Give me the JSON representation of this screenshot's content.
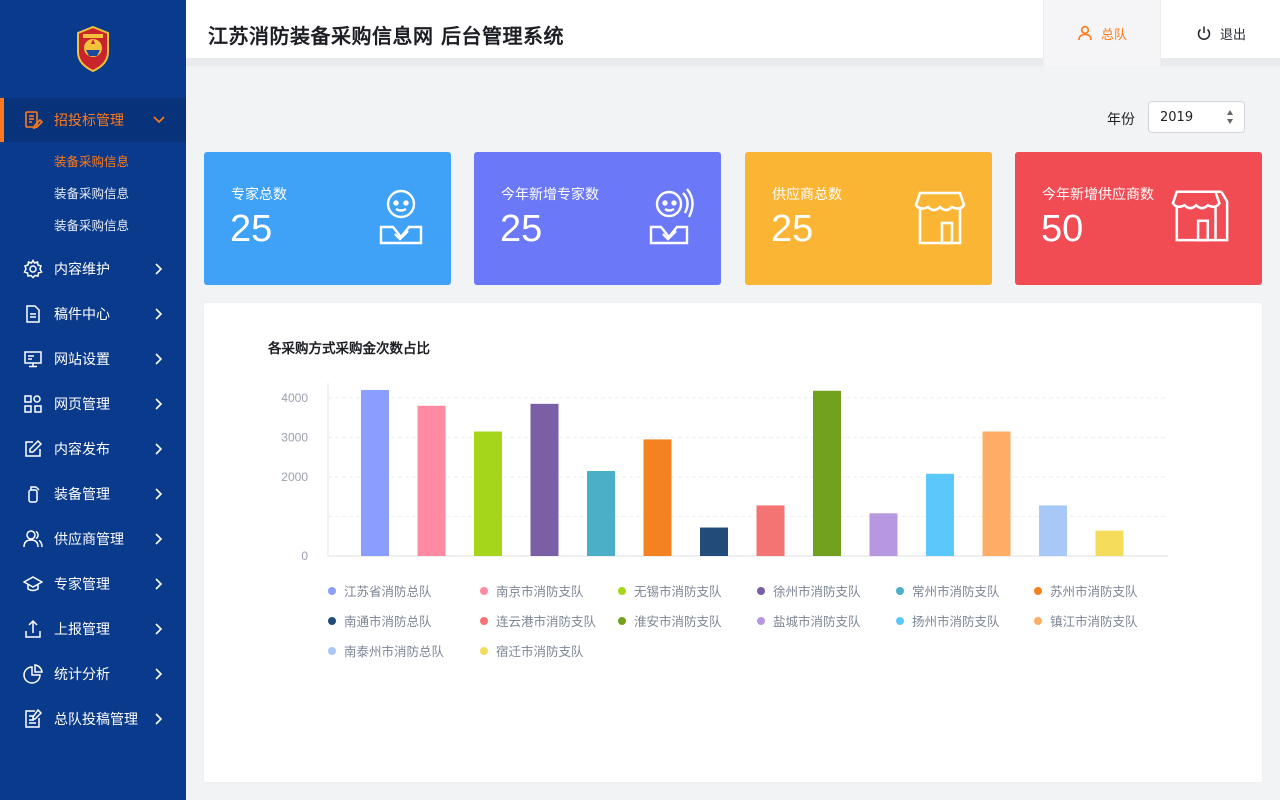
{
  "header": {
    "title": "江苏消防装备采购信息网  后台管理系统",
    "user_label": "总队",
    "logout_label": "退出"
  },
  "sidebar": {
    "active": {
      "label": "招投标管理",
      "icon": "document-edit-icon",
      "sub_items": [
        "装备采购信息",
        "装备采购信息",
        "装备采购信息"
      ]
    },
    "items": [
      {
        "label": "内容维护",
        "icon": "gear-icon"
      },
      {
        "label": "稿件中心",
        "icon": "file-icon"
      },
      {
        "label": "网站设置",
        "icon": "monitor-icon"
      },
      {
        "label": "网页管理",
        "icon": "grid-icon"
      },
      {
        "label": "内容发布",
        "icon": "edit-icon"
      },
      {
        "label": "装备管理",
        "icon": "extinguisher-icon"
      },
      {
        "label": "供应商管理",
        "icon": "users-icon"
      },
      {
        "label": "专家管理",
        "icon": "graduation-cap-icon"
      },
      {
        "label": "上报管理",
        "icon": "upload-icon"
      },
      {
        "label": "统计分析",
        "icon": "pie-chart-icon"
      },
      {
        "label": "总队投稿管理",
        "icon": "submission-icon"
      }
    ]
  },
  "filter": {
    "year_label": "年份",
    "year_value": "2019"
  },
  "cards": [
    {
      "label": "专家总数",
      "value": "25",
      "color": "#3fa2f7",
      "icon": "expert-icon"
    },
    {
      "label": "今年新增专家数",
      "value": "25",
      "color": "#6b78f7",
      "icon": "new-expert-icon"
    },
    {
      "label": "供应商总数",
      "value": "25",
      "color": "#fbb534",
      "icon": "store-icon"
    },
    {
      "label": "今年新增供应商数",
      "value": "50",
      "color": "#f14b54",
      "icon": "new-store-icon"
    }
  ],
  "chart_data": {
    "type": "bar",
    "title": "各采购方式采购金次数占比",
    "ylim": [
      0,
      4200
    ],
    "yticks": [
      0,
      2000,
      3000,
      4000
    ],
    "grid": true,
    "legend_position": "bottom",
    "categories": [
      "江苏省消防总队",
      "南京市消防支队",
      "无锡市消防支队",
      "徐州市消防支队",
      "常州市消防支队",
      "苏州市消防支队",
      "南通市消防总队",
      "连云港市消防支队",
      "淮安市消防支队",
      "盐城市消防支队",
      "扬州市消防支队",
      "镇江市消防支队",
      "南泰州市消防总队",
      "宿迁市消防支队"
    ],
    "values": [
      4200,
      3800,
      3150,
      3850,
      2150,
      2950,
      720,
      1280,
      4180,
      1080,
      2080,
      3150,
      1280,
      640
    ],
    "colors": [
      "#8b9eff",
      "#ff8aa2",
      "#a5d61c",
      "#7a5fa6",
      "#4aafc7",
      "#f58220",
      "#234b79",
      "#f37472",
      "#72a120",
      "#b797e0",
      "#5ac8fa",
      "#ffad66",
      "#a8c9f7",
      "#f5dc5a"
    ]
  }
}
